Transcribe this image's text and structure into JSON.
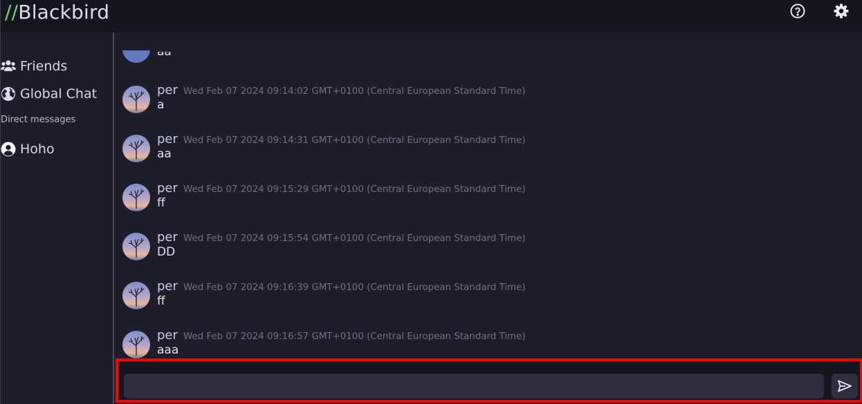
{
  "app": {
    "brand_prefix": "//",
    "brand_name": "Blackbird"
  },
  "topbar": {
    "icons": [
      "help-icon",
      "gear-icon"
    ]
  },
  "sidebar": {
    "items": [
      {
        "label": "Friends",
        "icon": "friends-icon"
      },
      {
        "label": "Global Chat",
        "icon": "globe-icon"
      }
    ],
    "dm_heading": "Direct messages",
    "dms": [
      {
        "label": "Hoho",
        "icon": "user-icon"
      }
    ]
  },
  "chat": {
    "partial_message_text": "aa",
    "messages": [
      {
        "user": "per",
        "time": "Wed Feb 07 2024 09:14:02 GMT+0100 (Central European Standard Time)",
        "text": "a"
      },
      {
        "user": "per",
        "time": "Wed Feb 07 2024 09:14:31 GMT+0100 (Central European Standard Time)",
        "text": "aa"
      },
      {
        "user": "per",
        "time": "Wed Feb 07 2024 09:15:29 GMT+0100 (Central European Standard Time)",
        "text": "ff"
      },
      {
        "user": "per",
        "time": "Wed Feb 07 2024 09:15:54 GMT+0100 (Central European Standard Time)",
        "text": "DD"
      },
      {
        "user": "per",
        "time": "Wed Feb 07 2024 09:16:39 GMT+0100 (Central European Standard Time)",
        "text": "ff"
      },
      {
        "user": "per",
        "time": "Wed Feb 07 2024 09:16:57 GMT+0100 (Central European Standard Time)",
        "text": "aaa"
      }
    ]
  },
  "composer": {
    "value": "",
    "placeholder": "",
    "send_icon": "send-icon"
  },
  "colors": {
    "background": "#1e1e2b",
    "topbar": "#161620",
    "brand_accent": "#7ed36e",
    "highlight": "#ff0000"
  }
}
